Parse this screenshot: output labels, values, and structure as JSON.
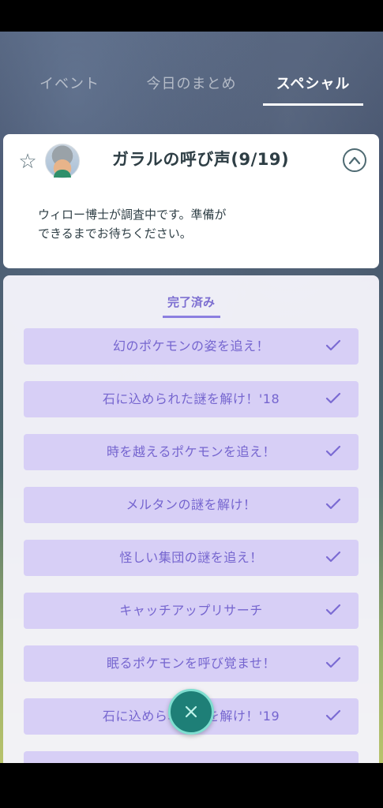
{
  "tabs": [
    {
      "label": "イベント"
    },
    {
      "label": "今日のまとめ"
    },
    {
      "label": "スペシャル"
    }
  ],
  "header": {
    "title": "ガラルの呼び声(9/19)",
    "description_lines": [
      "ウィロー博士が調査中です。準備が",
      "できるまでお待ちください。"
    ]
  },
  "section": {
    "label": "完了済み"
  },
  "quests": [
    {
      "label": "幻のポケモンの姿を追え！"
    },
    {
      "label": "石に込められた謎を解け！'18"
    },
    {
      "label": "時を越えるポケモンを追え！"
    },
    {
      "label": "メルタンの謎を解け！"
    },
    {
      "label": "怪しい集団の謎を追え！"
    },
    {
      "label": "キャッチアップリサーチ"
    },
    {
      "label": "眠るポケモンを呼び覚ませ！"
    },
    {
      "label": "石に込められた謎を解け！'19"
    }
  ],
  "icons": {
    "star": "star-icon",
    "collapse": "chevron-up-icon",
    "check": "check-icon",
    "close": "close-icon"
  },
  "colors": {
    "accent_purple": "#7565cf",
    "item_bg": "#d7cff6",
    "fab_teal": "#1e7f77"
  }
}
